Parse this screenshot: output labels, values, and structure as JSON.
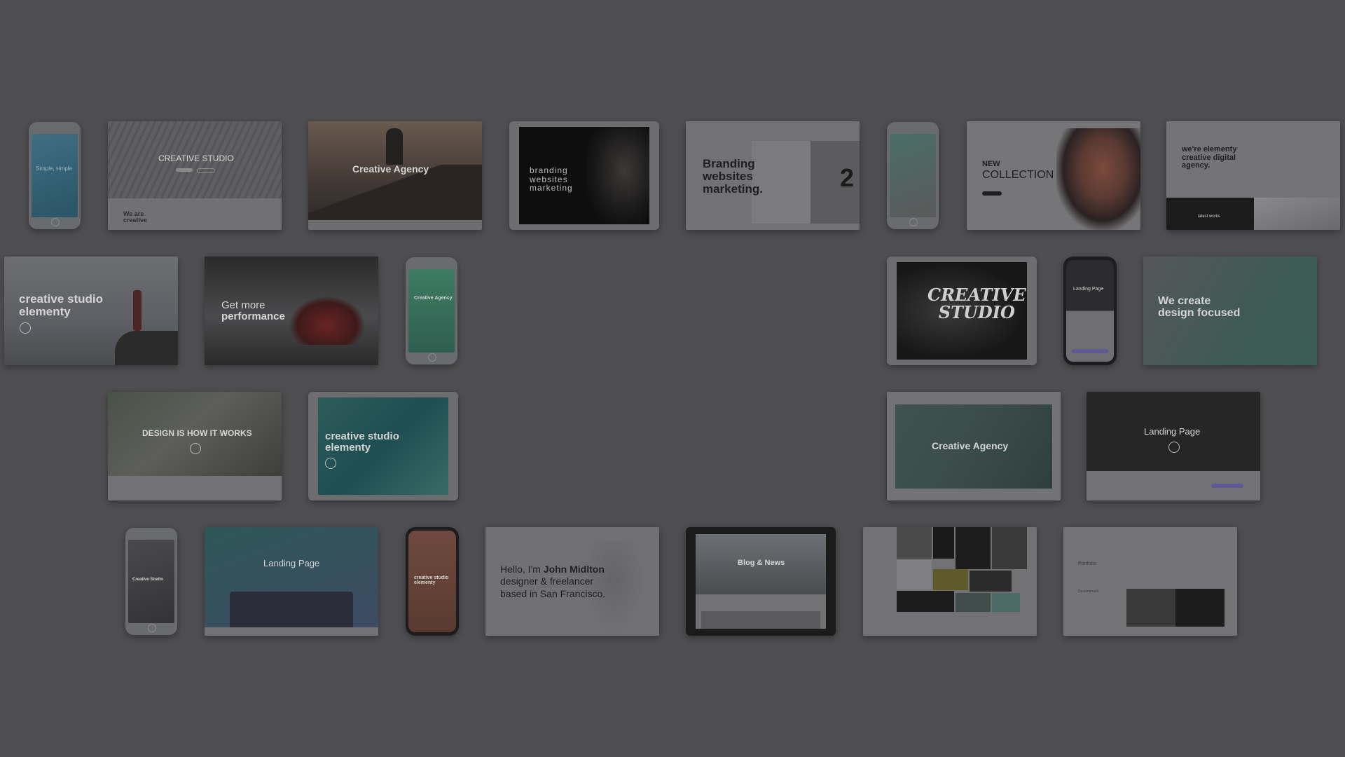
{
  "row1": {
    "simple": "Simple, simple",
    "creative_studio": "CREATIVE STUDIO",
    "we_are_creative": "We are\ncreative",
    "creative_agency": "Creative Agency",
    "branding_dark": "branding\nwebsites\nmarketing",
    "branding_light": "Branding\nwebsites\nmarketing.",
    "branding_number": "2",
    "new_collection_1": "NEW",
    "new_collection_2": "COLLECTION",
    "elementy_agency": "we're elementy\ncreative digital\nagency.",
    "latest_works": "latest works"
  },
  "row2": {
    "creative_studio_elementy": "creative studio\nelementy",
    "get_more": "Get more",
    "performance": "performance",
    "creative_agency_phone": "Creative Agency",
    "creative_studio_script": "CREATIVE\nSTUDIO",
    "landing_page_phone": "Landing Page",
    "we_create": "We create\ndesign focused"
  },
  "row3": {
    "design_works": "DESIGN IS HOW IT WORKS",
    "creative_studio_elementy": "creative studio\nelementy",
    "creative_agency": "Creative Agency",
    "landing_page": "Landing Page"
  },
  "row4": {
    "creative_studio_phone": "Creative Studio",
    "landing_page": "Landing Page",
    "creative_studio_elementy": "creative studio\nelementy",
    "hello_prefix": "Hello, I'm ",
    "hello_name": "John Midlton",
    "hello_rest": "designer & freelancer\nbased in San Francisco.",
    "blog_news": "Blog & News",
    "portfolio": "Portfolio",
    "development": "Development"
  },
  "colors": {
    "background": "#4f4f51"
  }
}
